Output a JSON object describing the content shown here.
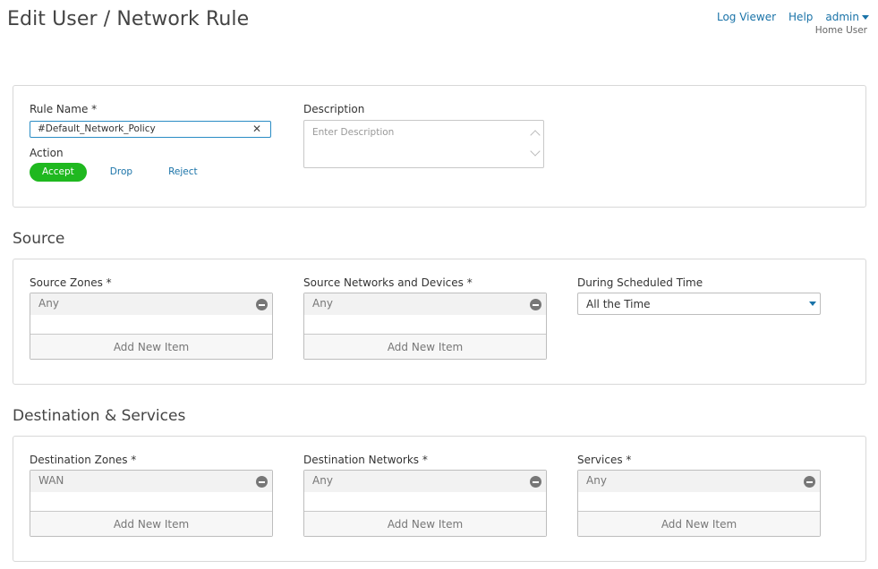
{
  "page": {
    "title": "Edit User / Network Rule"
  },
  "topnav": {
    "log_viewer": "Log Viewer",
    "help": "Help",
    "user": "admin",
    "user_role": "Home User"
  },
  "rule": {
    "name_label": "Rule Name *",
    "name_value": "#Default_Network_Policy",
    "description_label": "Description",
    "description_placeholder": "Enter Description",
    "action_label": "Action",
    "actions": [
      "Accept",
      "Drop",
      "Reject"
    ],
    "selected_action": "Accept"
  },
  "source": {
    "title": "Source",
    "zones_label": "Source Zones *",
    "zones_items": [
      "Any"
    ],
    "networks_label": "Source Networks and Devices *",
    "networks_items": [
      "Any"
    ],
    "schedule_label": "During Scheduled Time",
    "schedule_value": "All the Time"
  },
  "destination": {
    "title": "Destination & Services",
    "zones_label": "Destination Zones *",
    "zones_items": [
      "WAN"
    ],
    "networks_label": "Destination Networks *",
    "networks_items": [
      "Any"
    ],
    "services_label": "Services *",
    "services_items": [
      "Any"
    ]
  },
  "common": {
    "add_new_item": "Add New Item"
  },
  "colors": {
    "accent": "#1a73a8",
    "accept": "#1fb81f",
    "input_border": "#2a8cc4"
  }
}
